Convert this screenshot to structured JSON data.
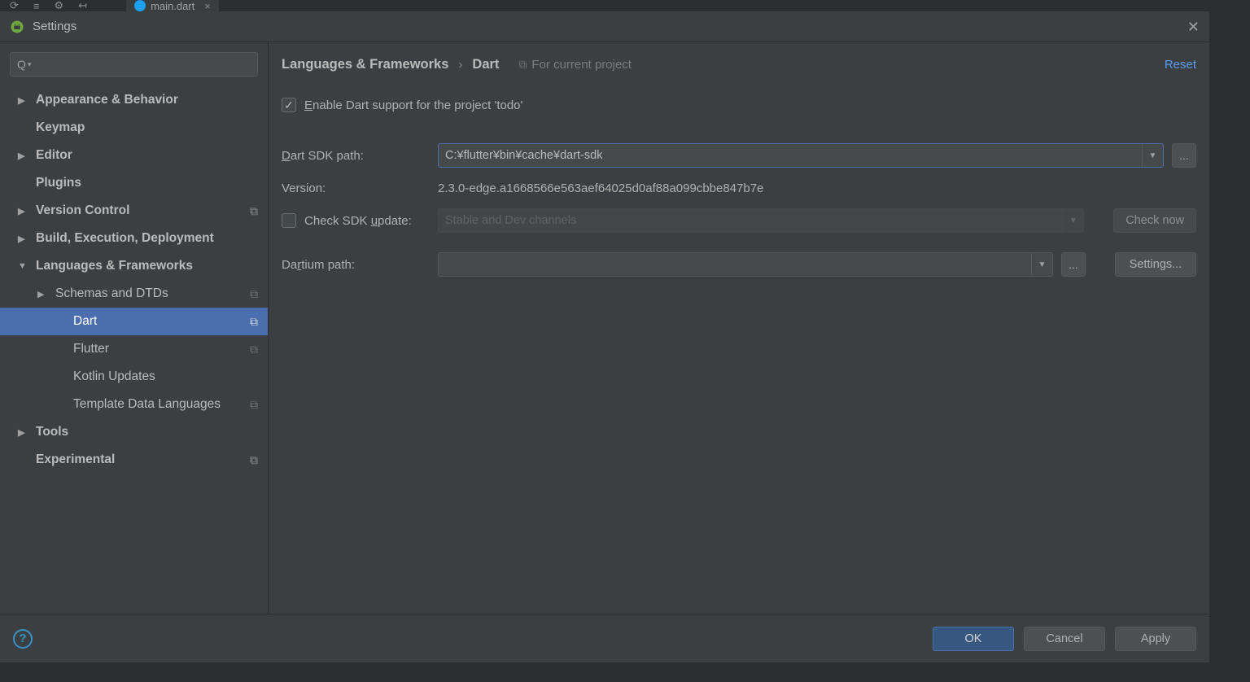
{
  "topbar": {
    "tab_label": "main.dart"
  },
  "modal": {
    "title": "Settings"
  },
  "breadcrumb": {
    "group": "Languages & Frameworks",
    "page": "Dart",
    "scope_note": "For current project",
    "reset": "Reset"
  },
  "search": {
    "placeholder": ""
  },
  "sidebar": {
    "items": [
      {
        "label": "Appearance & Behavior",
        "level": 0,
        "arrow": "right",
        "bold": true
      },
      {
        "label": "Keymap",
        "level": 0,
        "arrow": "none",
        "bold": true
      },
      {
        "label": "Editor",
        "level": 0,
        "arrow": "right",
        "bold": true
      },
      {
        "label": "Plugins",
        "level": 0,
        "arrow": "none",
        "bold": true
      },
      {
        "label": "Version Control",
        "level": 0,
        "arrow": "right",
        "bold": true,
        "scope": true
      },
      {
        "label": "Build, Execution, Deployment",
        "level": 0,
        "arrow": "right",
        "bold": true
      },
      {
        "label": "Languages & Frameworks",
        "level": 0,
        "arrow": "down",
        "bold": true
      },
      {
        "label": "Schemas and DTDs",
        "level": 1,
        "arrow": "right",
        "scope": true
      },
      {
        "label": "Dart",
        "level": 2,
        "arrow": "none",
        "selected": true,
        "scope": true
      },
      {
        "label": "Flutter",
        "level": 2,
        "arrow": "none",
        "scope": true
      },
      {
        "label": "Kotlin Updates",
        "level": 2,
        "arrow": "none"
      },
      {
        "label": "Template Data Languages",
        "level": 2,
        "arrow": "none",
        "scope": true
      },
      {
        "label": "Tools",
        "level": 0,
        "arrow": "right",
        "bold": true
      },
      {
        "label": "Experimental",
        "level": 0,
        "arrow": "none",
        "bold": true,
        "scope": true
      }
    ]
  },
  "form": {
    "enable_label_pre": "E",
    "enable_label_post": "nable Dart support for the project 'todo'",
    "sdk_path_label_pre": "D",
    "sdk_path_label_post": "art SDK path:",
    "sdk_path_value": "C:¥flutter¥bin¥cache¥dart-sdk",
    "version_label": "Version:",
    "version_value": "2.3.0-edge.a1668566e563aef64025d0af88a099cbbe847b7e",
    "check_update_label_pre": "Check SDK ",
    "check_update_label_u": "u",
    "check_update_label_post": "pdate:",
    "channels_placeholder": "Stable and Dev channels",
    "check_now": "Check now",
    "dartium_label_pre": "Da",
    "dartium_label_u": "r",
    "dartium_label_post": "tium path:",
    "settings_button": "Settings...",
    "browse_button": "..."
  },
  "footer": {
    "ok": "OK",
    "cancel": "Cancel",
    "apply": "Apply"
  }
}
